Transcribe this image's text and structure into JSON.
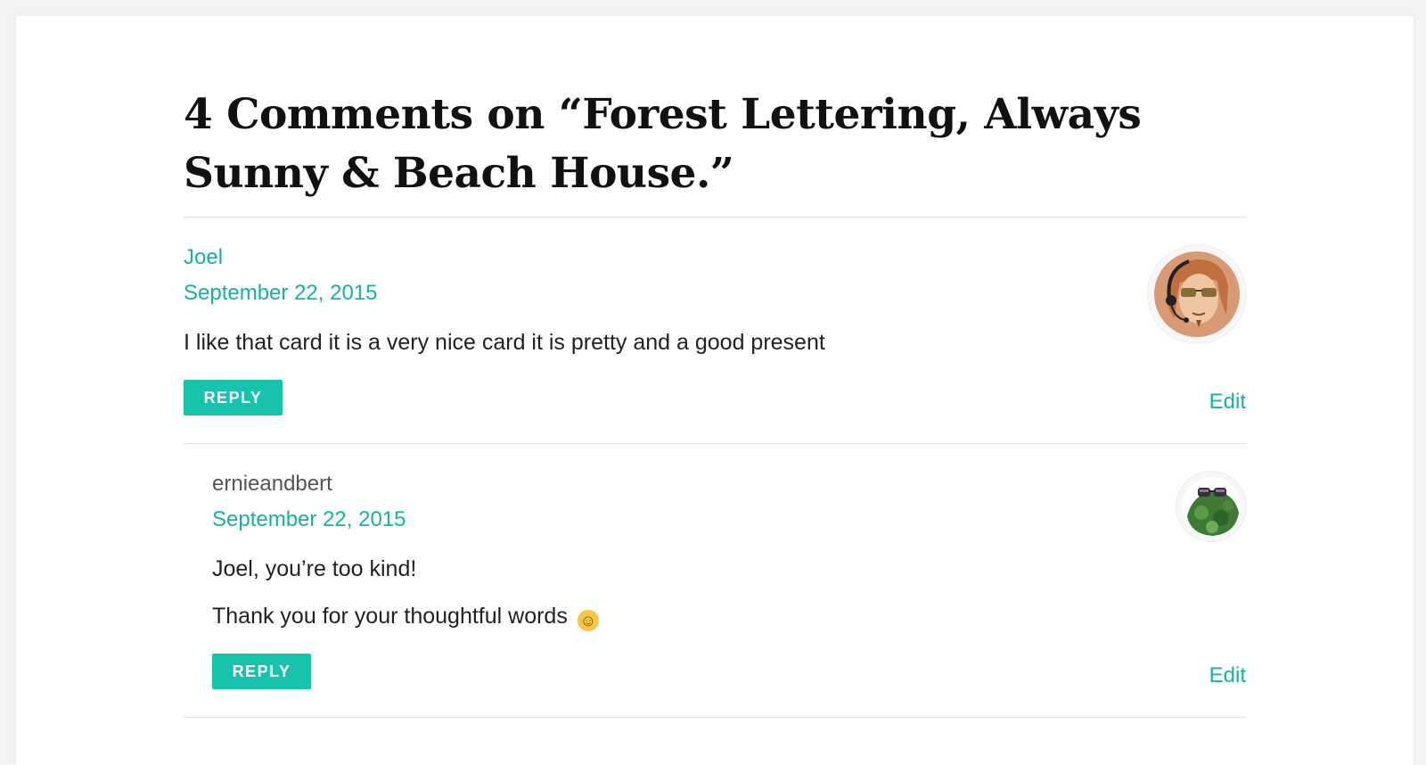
{
  "comments_title": "4 Comments on “Forest Lettering, Always Sunny & Beach House.”",
  "comments": [
    {
      "author": "Joel",
      "date": "September 22, 2015",
      "paragraphs": [
        "I like that card it is a very nice card it is pretty and a good present"
      ],
      "reply_label": "REPLY",
      "edit_label": "Edit",
      "avatar_icon": "avatar-man-with-headset-sunglasses"
    },
    {
      "author": "ernieandbert",
      "date": "September 22, 2015",
      "paragraphs": [
        "Joel, you’re too kind!",
        "Thank you for your thoughtful words"
      ],
      "emoji": "slightly-smiling-face-emoji",
      "reply_label": "REPLY",
      "edit_label": "Edit",
      "avatar_icon": "avatar-green-plant-with-sunglasses"
    }
  ],
  "colors": {
    "accent": "#16b39f",
    "button": "#18c3ad",
    "background": "#f3f3f3",
    "card": "#ffffff"
  }
}
